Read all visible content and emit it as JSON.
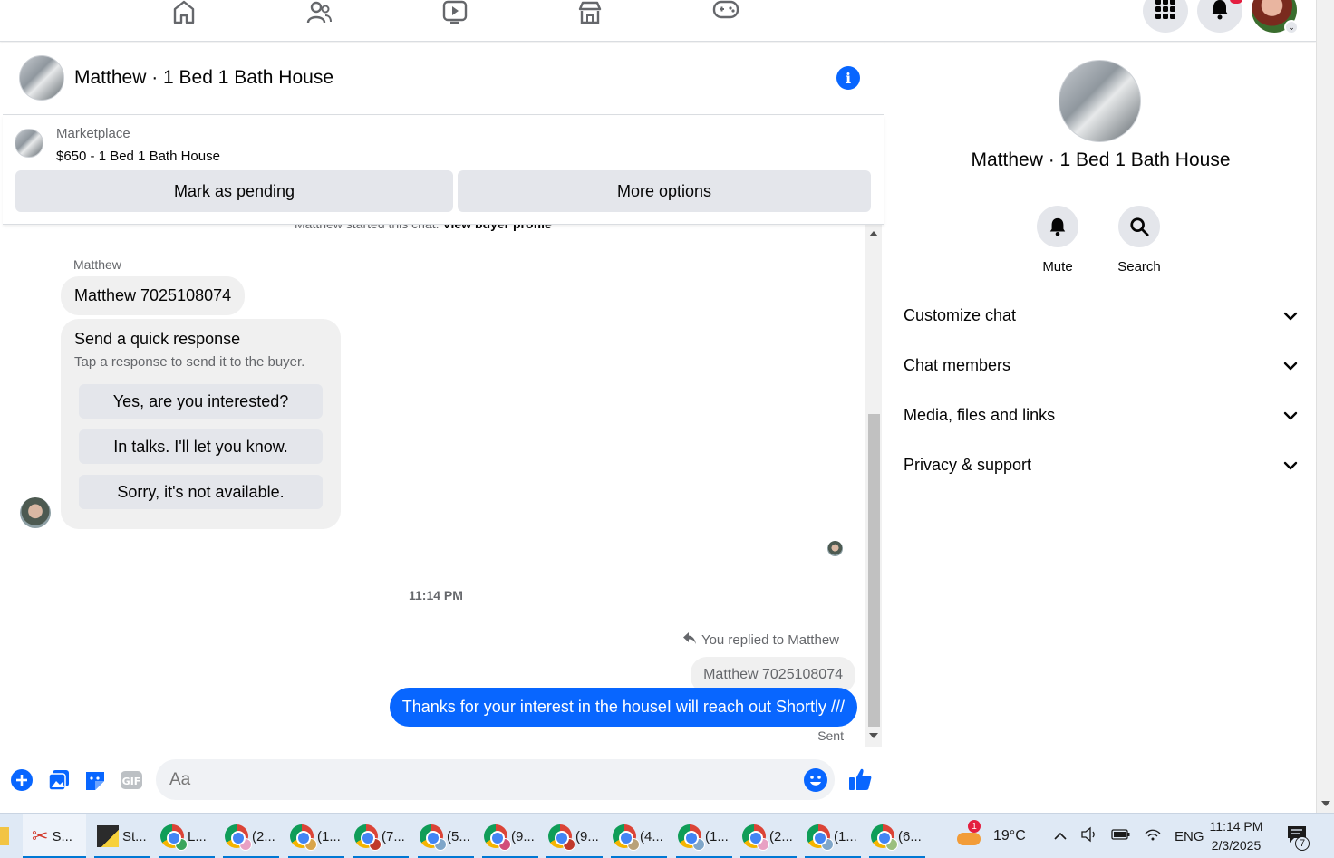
{
  "chat": {
    "title": "Matthew · 1 Bed 1 Bath House",
    "marketplace_label": "Marketplace",
    "listing": "$650 - 1 Bed 1 Bath House",
    "mark_pending_label": "Mark as pending",
    "more_options_label": "More options",
    "started_text": "Matthew started this chat.",
    "view_profile_label": "View buyer profile",
    "sender_name": "Matthew",
    "incoming_message": "Matthew 7025108074",
    "quick_response": {
      "title": "Send a quick response",
      "subtitle": "Tap a response to send it to the buyer.",
      "options": [
        "Yes, are you interested?",
        "In talks. I'll let you know.",
        "Sorry, it's not available."
      ]
    },
    "timestamp": "11:14 PM",
    "replied_to": "You replied to Matthew",
    "quoted_message": "Matthew 7025108074",
    "outgoing_message": "Thanks for your interest in the houseI will reach out Shortly ///",
    "status": "Sent",
    "composer_placeholder": "Aa"
  },
  "info_panel": {
    "title": "Matthew · 1 Bed 1 Bath House",
    "actions": [
      {
        "label": "Mute",
        "icon": "bell-icon"
      },
      {
        "label": "Search",
        "icon": "search-icon"
      }
    ],
    "sections": [
      "Customize chat",
      "Chat members",
      "Media, files and links",
      "Privacy & support"
    ]
  },
  "colors": {
    "accent": "#0866ff",
    "bubble_gray": "#f0f0f0",
    "button_gray": "#e4e6eb",
    "secondary_text": "#65676b"
  },
  "taskbar": {
    "items": [
      "S...",
      "St...",
      "L...",
      "(2...",
      "(1...",
      "(7...",
      "(5...",
      "(9...",
      "(9...",
      "(4...",
      "(1...",
      "(2...",
      "(1...",
      "(6..."
    ],
    "weather_badge": "1",
    "temperature": "19°C",
    "language": "ENG",
    "time": "11:14 PM",
    "date": "2/3/2025",
    "notification_count": "7"
  }
}
